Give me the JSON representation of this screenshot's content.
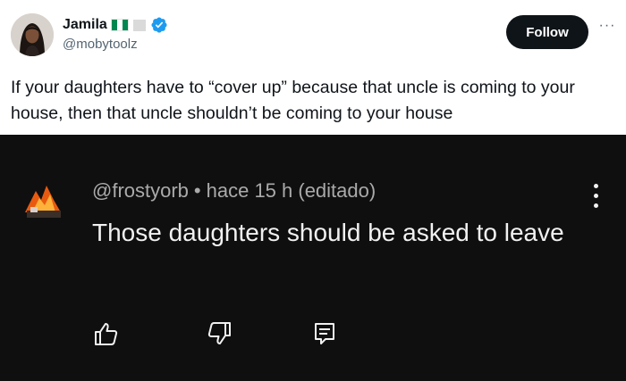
{
  "tweet": {
    "display_name": "Jamila",
    "handle": "@mobytoolz",
    "follow_label": "Follow",
    "more_label": "···",
    "text": "If your daughters have to “cover up” because that uncle is coming to your house, then that uncle shouldn’t be coming to your house",
    "flag_colors": [
      "#008751",
      "#ffffff",
      "#008751"
    ],
    "verified_color": "#1d9bf0"
  },
  "comment": {
    "username": "@frostyorb",
    "separator": "•",
    "time": "hace 15 h (editado)",
    "text": "Those daughters should be asked to leave",
    "actions": [
      "like-icon",
      "dislike-icon",
      "reply-icon"
    ]
  }
}
